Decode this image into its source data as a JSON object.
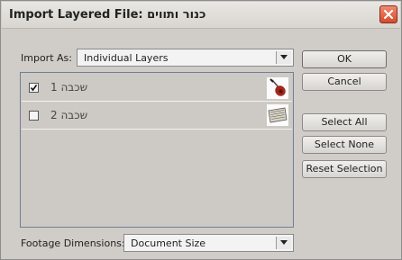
{
  "dialog": {
    "title": "Import Layered File: כנור ותווים"
  },
  "import_as": {
    "label": "Import As:",
    "value": "Individual Layers"
  },
  "layers": [
    {
      "name": "שכבה 1",
      "checked": true,
      "thumbnail": "violin-thumbnail"
    },
    {
      "name": "שכבה 2",
      "checked": false,
      "thumbnail": "sheet-music-thumbnail"
    }
  ],
  "buttons": {
    "ok": "OK",
    "cancel": "Cancel",
    "select_all": "Select All",
    "select_none": "Select None",
    "reset_selection": "Reset Selection"
  },
  "footage": {
    "label": "Footage Dimensions:",
    "value": "Document Size"
  }
}
